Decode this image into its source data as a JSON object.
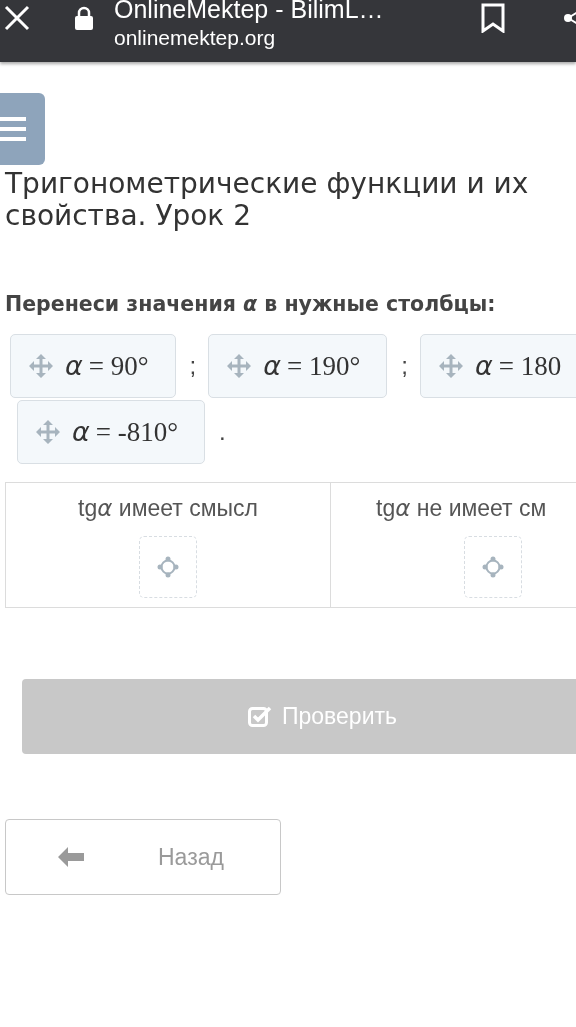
{
  "browser": {
    "title": "OnlineMektep - BilimL…",
    "url": "onlinemektep.org"
  },
  "lesson_title": "Тригонометрические функции и их свойства. Урок 2",
  "question": "Перенеси значения *α* в нужные столбцы:",
  "chips": [
    {
      "prefix": "α",
      "value": "= 90°",
      "separator": ";"
    },
    {
      "prefix": "α",
      "value": "= 190°",
      "separator": ";"
    },
    {
      "prefix": "α",
      "value": "= 180"
    },
    {
      "prefix": "α",
      "value": "= -810°",
      "separator": "."
    }
  ],
  "columns": [
    {
      "function": "tg",
      "symbol": "α",
      "rest": " имеет смысл"
    },
    {
      "function": "tg",
      "symbol": "α",
      "rest": " не имеет см"
    }
  ],
  "check_button": {
    "label": "Проверить",
    "disabled": true
  },
  "back_button": {
    "label": "Назад"
  }
}
